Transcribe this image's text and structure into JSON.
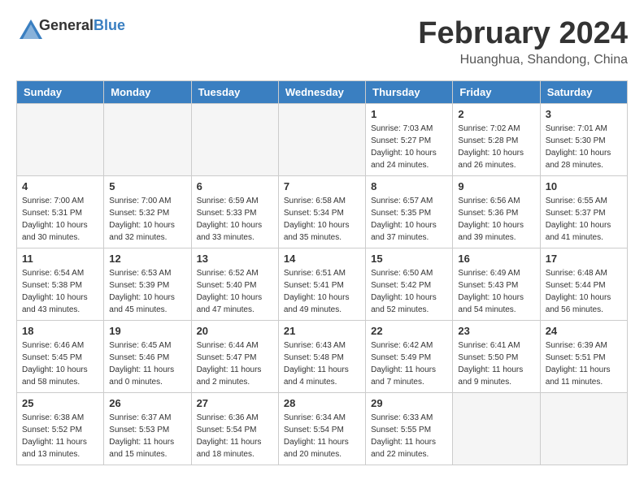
{
  "header": {
    "logo_general": "General",
    "logo_blue": "Blue",
    "month_title": "February 2024",
    "location": "Huanghua, Shandong, China"
  },
  "weekdays": [
    "Sunday",
    "Monday",
    "Tuesday",
    "Wednesday",
    "Thursday",
    "Friday",
    "Saturday"
  ],
  "weeks": [
    [
      {
        "day": "",
        "sunrise": "",
        "sunset": "",
        "daylight": "",
        "empty": true
      },
      {
        "day": "",
        "sunrise": "",
        "sunset": "",
        "daylight": "",
        "empty": true
      },
      {
        "day": "",
        "sunrise": "",
        "sunset": "",
        "daylight": "",
        "empty": true
      },
      {
        "day": "",
        "sunrise": "",
        "sunset": "",
        "daylight": "",
        "empty": true
      },
      {
        "day": "1",
        "sunrise": "Sunrise: 7:03 AM",
        "sunset": "Sunset: 5:27 PM",
        "daylight": "Daylight: 10 hours and 24 minutes.",
        "empty": false
      },
      {
        "day": "2",
        "sunrise": "Sunrise: 7:02 AM",
        "sunset": "Sunset: 5:28 PM",
        "daylight": "Daylight: 10 hours and 26 minutes.",
        "empty": false
      },
      {
        "day": "3",
        "sunrise": "Sunrise: 7:01 AM",
        "sunset": "Sunset: 5:30 PM",
        "daylight": "Daylight: 10 hours and 28 minutes.",
        "empty": false
      }
    ],
    [
      {
        "day": "4",
        "sunrise": "Sunrise: 7:00 AM",
        "sunset": "Sunset: 5:31 PM",
        "daylight": "Daylight: 10 hours and 30 minutes.",
        "empty": false
      },
      {
        "day": "5",
        "sunrise": "Sunrise: 7:00 AM",
        "sunset": "Sunset: 5:32 PM",
        "daylight": "Daylight: 10 hours and 32 minutes.",
        "empty": false
      },
      {
        "day": "6",
        "sunrise": "Sunrise: 6:59 AM",
        "sunset": "Sunset: 5:33 PM",
        "daylight": "Daylight: 10 hours and 33 minutes.",
        "empty": false
      },
      {
        "day": "7",
        "sunrise": "Sunrise: 6:58 AM",
        "sunset": "Sunset: 5:34 PM",
        "daylight": "Daylight: 10 hours and 35 minutes.",
        "empty": false
      },
      {
        "day": "8",
        "sunrise": "Sunrise: 6:57 AM",
        "sunset": "Sunset: 5:35 PM",
        "daylight": "Daylight: 10 hours and 37 minutes.",
        "empty": false
      },
      {
        "day": "9",
        "sunrise": "Sunrise: 6:56 AM",
        "sunset": "Sunset: 5:36 PM",
        "daylight": "Daylight: 10 hours and 39 minutes.",
        "empty": false
      },
      {
        "day": "10",
        "sunrise": "Sunrise: 6:55 AM",
        "sunset": "Sunset: 5:37 PM",
        "daylight": "Daylight: 10 hours and 41 minutes.",
        "empty": false
      }
    ],
    [
      {
        "day": "11",
        "sunrise": "Sunrise: 6:54 AM",
        "sunset": "Sunset: 5:38 PM",
        "daylight": "Daylight: 10 hours and 43 minutes.",
        "empty": false
      },
      {
        "day": "12",
        "sunrise": "Sunrise: 6:53 AM",
        "sunset": "Sunset: 5:39 PM",
        "daylight": "Daylight: 10 hours and 45 minutes.",
        "empty": false
      },
      {
        "day": "13",
        "sunrise": "Sunrise: 6:52 AM",
        "sunset": "Sunset: 5:40 PM",
        "daylight": "Daylight: 10 hours and 47 minutes.",
        "empty": false
      },
      {
        "day": "14",
        "sunrise": "Sunrise: 6:51 AM",
        "sunset": "Sunset: 5:41 PM",
        "daylight": "Daylight: 10 hours and 49 minutes.",
        "empty": false
      },
      {
        "day": "15",
        "sunrise": "Sunrise: 6:50 AM",
        "sunset": "Sunset: 5:42 PM",
        "daylight": "Daylight: 10 hours and 52 minutes.",
        "empty": false
      },
      {
        "day": "16",
        "sunrise": "Sunrise: 6:49 AM",
        "sunset": "Sunset: 5:43 PM",
        "daylight": "Daylight: 10 hours and 54 minutes.",
        "empty": false
      },
      {
        "day": "17",
        "sunrise": "Sunrise: 6:48 AM",
        "sunset": "Sunset: 5:44 PM",
        "daylight": "Daylight: 10 hours and 56 minutes.",
        "empty": false
      }
    ],
    [
      {
        "day": "18",
        "sunrise": "Sunrise: 6:46 AM",
        "sunset": "Sunset: 5:45 PM",
        "daylight": "Daylight: 10 hours and 58 minutes.",
        "empty": false
      },
      {
        "day": "19",
        "sunrise": "Sunrise: 6:45 AM",
        "sunset": "Sunset: 5:46 PM",
        "daylight": "Daylight: 11 hours and 0 minutes.",
        "empty": false
      },
      {
        "day": "20",
        "sunrise": "Sunrise: 6:44 AM",
        "sunset": "Sunset: 5:47 PM",
        "daylight": "Daylight: 11 hours and 2 minutes.",
        "empty": false
      },
      {
        "day": "21",
        "sunrise": "Sunrise: 6:43 AM",
        "sunset": "Sunset: 5:48 PM",
        "daylight": "Daylight: 11 hours and 4 minutes.",
        "empty": false
      },
      {
        "day": "22",
        "sunrise": "Sunrise: 6:42 AM",
        "sunset": "Sunset: 5:49 PM",
        "daylight": "Daylight: 11 hours and 7 minutes.",
        "empty": false
      },
      {
        "day": "23",
        "sunrise": "Sunrise: 6:41 AM",
        "sunset": "Sunset: 5:50 PM",
        "daylight": "Daylight: 11 hours and 9 minutes.",
        "empty": false
      },
      {
        "day": "24",
        "sunrise": "Sunrise: 6:39 AM",
        "sunset": "Sunset: 5:51 PM",
        "daylight": "Daylight: 11 hours and 11 minutes.",
        "empty": false
      }
    ],
    [
      {
        "day": "25",
        "sunrise": "Sunrise: 6:38 AM",
        "sunset": "Sunset: 5:52 PM",
        "daylight": "Daylight: 11 hours and 13 minutes.",
        "empty": false
      },
      {
        "day": "26",
        "sunrise": "Sunrise: 6:37 AM",
        "sunset": "Sunset: 5:53 PM",
        "daylight": "Daylight: 11 hours and 15 minutes.",
        "empty": false
      },
      {
        "day": "27",
        "sunrise": "Sunrise: 6:36 AM",
        "sunset": "Sunset: 5:54 PM",
        "daylight": "Daylight: 11 hours and 18 minutes.",
        "empty": false
      },
      {
        "day": "28",
        "sunrise": "Sunrise: 6:34 AM",
        "sunset": "Sunset: 5:54 PM",
        "daylight": "Daylight: 11 hours and 20 minutes.",
        "empty": false
      },
      {
        "day": "29",
        "sunrise": "Sunrise: 6:33 AM",
        "sunset": "Sunset: 5:55 PM",
        "daylight": "Daylight: 11 hours and 22 minutes.",
        "empty": false
      },
      {
        "day": "",
        "sunrise": "",
        "sunset": "",
        "daylight": "",
        "empty": true
      },
      {
        "day": "",
        "sunrise": "",
        "sunset": "",
        "daylight": "",
        "empty": true
      }
    ]
  ]
}
